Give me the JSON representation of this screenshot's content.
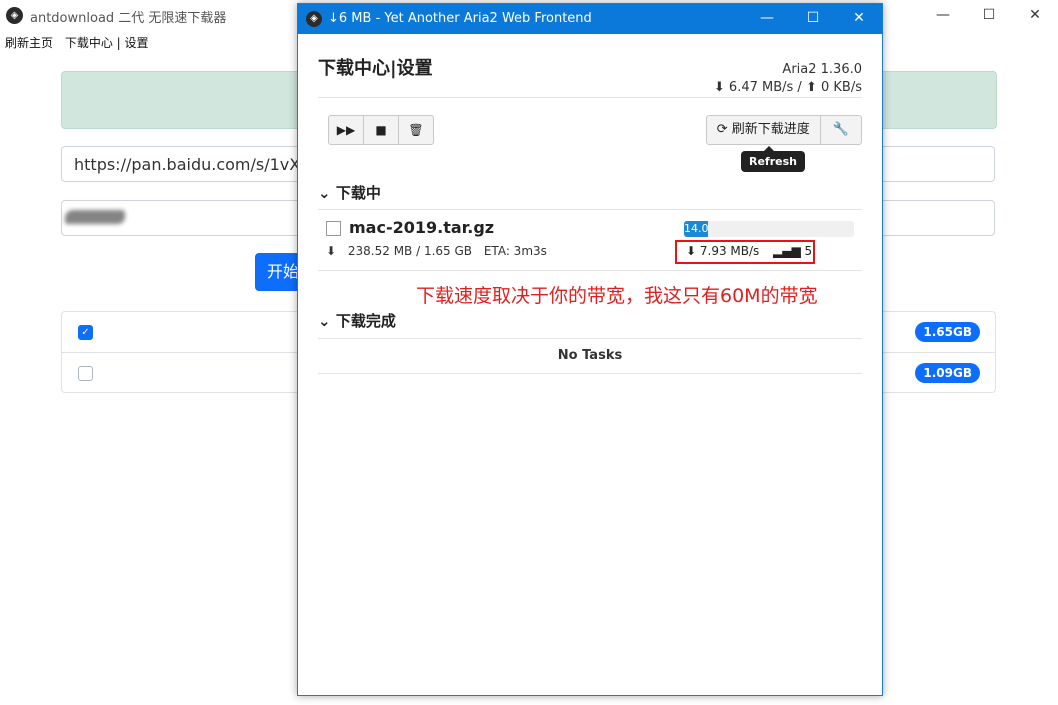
{
  "background_app": {
    "title": "antdownload 二代 无限速下载器",
    "nav": [
      "刷新主页",
      "下载中心 | 设置"
    ],
    "url_value": "https://pan.baidu.com/s/1vX_",
    "start_label": "开始",
    "files": [
      {
        "checked": true,
        "size": "1.65GB"
      },
      {
        "checked": false,
        "size": "1.09GB"
      }
    ]
  },
  "window": {
    "title": "↓6 MB - Yet Another Aria2 Web Frontend",
    "heading": "下载中心|设置",
    "version": "Aria2 1.36.0",
    "download_speed": "6.47 MB/s",
    "upload_speed": "0 KB/s",
    "refresh_label": "刷新下载进度",
    "tooltip": "Refresh",
    "downloading_section": "下载中",
    "completed_section": "下载完成",
    "no_tasks": "No Tasks",
    "task": {
      "name": "mac-2019.tar.gz",
      "size": "238.52 MB / 1.65 GB",
      "eta": "ETA: 3m3s",
      "progress_label": "14.08%",
      "progress": 0.14,
      "speed": "7.93 MB/s",
      "connections": "5"
    },
    "annotation": "下载速度取决于你的带宽，我这只有60M的带宽"
  }
}
